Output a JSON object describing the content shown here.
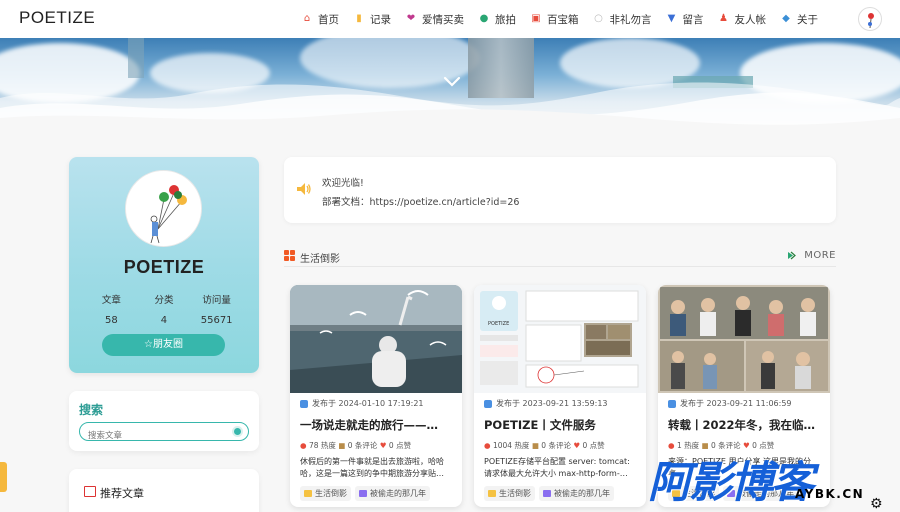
{
  "header": {
    "logo": "POETIZE",
    "nav": [
      {
        "label": "首页",
        "icon": "home-icon",
        "color": "#e74c3c"
      },
      {
        "label": "记录",
        "icon": "notebook-icon",
        "color": "#f5b83d"
      },
      {
        "label": "爱情买卖",
        "icon": "heart-icon",
        "color": "#c0398e"
      },
      {
        "label": "旅拍",
        "icon": "globe-icon",
        "color": "#2aa673"
      },
      {
        "label": "百宝箱",
        "icon": "toolbox-icon",
        "color": "#e74c3c"
      },
      {
        "label": "非礼勿言",
        "icon": "speech-bubble-icon",
        "color": "#bbbbbb"
      },
      {
        "label": "留言",
        "icon": "message-icon",
        "color": "#3b6fd6"
      },
      {
        "label": "友人帐",
        "icon": "friends-icon",
        "color": "#e74c3c"
      },
      {
        "label": "关于",
        "icon": "about-icon",
        "color": "#3b8fd6"
      }
    ]
  },
  "profile": {
    "name": "POETIZE",
    "stats": [
      {
        "label": "文章",
        "value": "58"
      },
      {
        "label": "分类",
        "value": "4"
      },
      {
        "label": "访问量",
        "value": "55671"
      }
    ],
    "friend_button": "☆朋友圈"
  },
  "search": {
    "title": "搜索",
    "placeholder": "搜索文章"
  },
  "recommend": {
    "title": "推荐文章"
  },
  "welcome": {
    "line1": "欢迎光临!",
    "line2": "部署文档：https://poetize.cn/article?id=26"
  },
  "section": {
    "title": "生活倒影",
    "more": "MORE"
  },
  "cards": [
    {
      "date": "发布于 2024-01-10 17:19:21",
      "title": "一场说走就走的旅行——…",
      "meta_hot": "78 热度",
      "meta_comment": "0 条评论",
      "meta_like": "0 点赞",
      "excerpt": "休假后的第一件事就是出去旅游啦，哈哈哈，这是一篇这到的争中期旅游分享贴…",
      "tags": [
        "生活倒影",
        "被偷走的那几年"
      ]
    },
    {
      "date": "发布于 2023-09-21 13:59:13",
      "title": "POETIZE丨文件服务",
      "meta_hot": "1004 热度",
      "meta_comment": "0 条评论",
      "meta_like": "0 点赞",
      "excerpt": "POETIZE存储平台配置 server: tomcat: 请求体最大允许大小 max-http-form-…",
      "tags": [
        "生活倒影",
        "被偷走的那几年"
      ]
    },
    {
      "date": "发布于 2023-09-21 11:06:59",
      "title": "转载丨2022年冬，我在临…",
      "meta_hot": "1 热度",
      "meta_comment": "0 条评论",
      "meta_like": "0 点赞",
      "excerpt": "来源：POETIZE 用户分享 这里是我的分享…",
      "tags": [
        "生活倒影",
        "被偷走的那几年"
      ]
    }
  ],
  "watermark": {
    "big": "阿影博客",
    "small": "AYBK.CN"
  }
}
